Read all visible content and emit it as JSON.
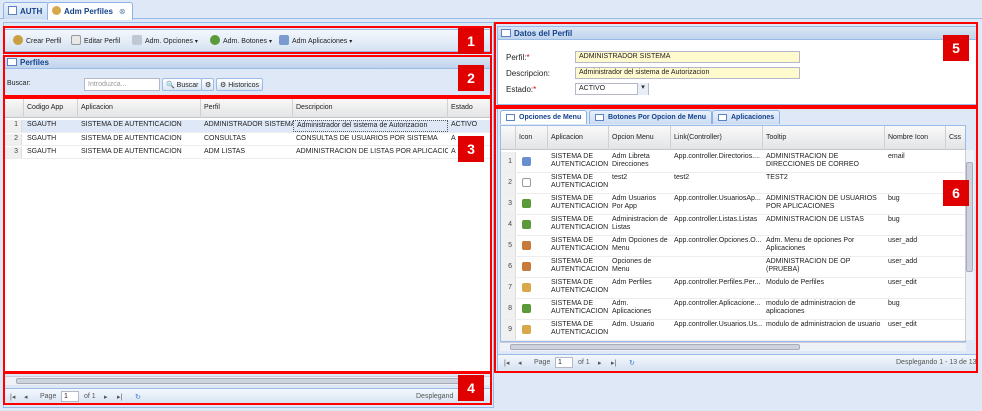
{
  "tabs": [
    {
      "label": "AUTH"
    },
    {
      "label": "Adm Perfiles"
    }
  ],
  "toolbar": {
    "crear": "Crear Perfil",
    "editar": "Editar Perfil",
    "opciones": "Adm. Opciones",
    "botones": "Adm. Botones",
    "aplicaciones": "Adm Aplicaciones"
  },
  "perfiles": {
    "title": "Perfiles",
    "search_label": "Buscar:",
    "search_placeholder": "Introduzca...",
    "buscar_btn": "Buscar",
    "historicos_btn": "Historicos",
    "columns": [
      "Codigo App",
      "Aplicacion",
      "Perfil",
      "Descripcion",
      "Estado"
    ],
    "rows": [
      [
        "1",
        "SGAUTH",
        "SISTEMA DE AUTENTICACION",
        "ADMINISTRADOR SISTEMA",
        "Administrador del sistema de Autorizacion",
        "ACTIVO"
      ],
      [
        "2",
        "SGAUTH",
        "SISTEMA DE AUTENTICACION",
        "CONSULTAS",
        "CONSULTAS DE USUARIOS POR SISTEMA",
        "A"
      ],
      [
        "3",
        "SGAUTH",
        "SISTEMA DE AUTENTICACION",
        "ADM LISTAS",
        "ADMINISTRACION DE LISTAS POR APLICACION",
        "A"
      ]
    ],
    "pager": {
      "page_label": "Page",
      "page": "1",
      "of": "of 1",
      "status": "Desplegand"
    }
  },
  "datos": {
    "title": "Datos del Perfil",
    "perfil_label": "Perfil:",
    "perfil_value": "ADMINISTRADOR SISTEMA",
    "descripcion_label": "Descripcion:",
    "descripcion_value": "Administrador del sistema de Autorizacion",
    "estado_label": "Estado:",
    "estado_value": "ACTIVO"
  },
  "subtabs": [
    "Opciones de Menu",
    "Botones Por Opcion de Menu",
    "Aplicaciones"
  ],
  "opciones": {
    "columns": [
      "Icon",
      "Aplicacion",
      "Opcion Menu",
      "Link(Controller)",
      "Tooltip",
      "Nombre Icon",
      "Css"
    ],
    "rows": [
      {
        "n": "1",
        "icon": "email",
        "color": "#6a8fd0",
        "app": "SISTEMA DE AUTENTICACION",
        "opcion": "Adm Libreta Direcciones",
        "link": "App.controller.Directorios....",
        "tooltip": "ADMINISTRACION DE DIRECCIONES DE CORREO",
        "nombre": "email"
      },
      {
        "n": "2",
        "icon": "blank",
        "color": "#dddddd",
        "app": "SISTEMA DE AUTENTICACION",
        "opcion": "test2",
        "link": "test2",
        "tooltip": "TEST2",
        "nombre": ""
      },
      {
        "n": "3",
        "icon": "bug",
        "color": "#5a9a3a",
        "app": "SISTEMA DE AUTENTICACION",
        "opcion": "Adm Usuarios Por App",
        "link": "App.controller.UsuariosAp...",
        "tooltip": "ADMINISTRACION DE USUARIOS POR APLICACIONES",
        "nombre": "bug"
      },
      {
        "n": "4",
        "icon": "bug",
        "color": "#5a9a3a",
        "app": "SISTEMA DE AUTENTICACION",
        "opcion": "Administracion de Listas",
        "link": "App.controller.Listas.Listas",
        "tooltip": "ADMINISTRACION DE LISTAS",
        "nombre": "bug"
      },
      {
        "n": "5",
        "icon": "user-add",
        "color": "#c77a3a",
        "app": "SISTEMA DE AUTENTICACION",
        "opcion": "Adm Opciones de Menu",
        "link": "App.controller.Opciones.O...",
        "tooltip": "Adm. Menu de opciones Por Aplicaciones",
        "nombre": "user_add"
      },
      {
        "n": "6",
        "icon": "user-add",
        "color": "#c77a3a",
        "app": "SISTEMA DE AUTENTICACION",
        "opcion": "Opciones de Menu",
        "link": "",
        "tooltip": "ADMINISTRACION DE OP (PRUEBA)",
        "nombre": "user_add"
      },
      {
        "n": "7",
        "icon": "user-edit",
        "color": "#d9a84a",
        "app": "SISTEMA DE AUTENTICACION",
        "opcion": "Adm Perfiles",
        "link": "App.controller.Perfiles.Per...",
        "tooltip": "Modulo de Perfiles",
        "nombre": "user_edit"
      },
      {
        "n": "8",
        "icon": "bug",
        "color": "#5a9a3a",
        "app": "SISTEMA DE AUTENTICACION",
        "opcion": "Adm. Aplicaciones",
        "link": "App.controller.Aplicacione...",
        "tooltip": "modulo de administracion de aplicaciones",
        "nombre": "bug"
      },
      {
        "n": "9",
        "icon": "user-edit",
        "color": "#d9a84a",
        "app": "SISTEMA DE AUTENTICACION",
        "opcion": "Adm. Usuario",
        "link": "App.controller.Usuarios.Us...",
        "tooltip": "modulo de administracion de usuario",
        "nombre": "user_edit"
      }
    ],
    "pager": {
      "page_label": "Page",
      "page": "1",
      "of": "of 1",
      "status": "Desplegando 1 - 13 de 13"
    }
  },
  "callouts": [
    "1",
    "2",
    "3",
    "4",
    "5",
    "6"
  ]
}
